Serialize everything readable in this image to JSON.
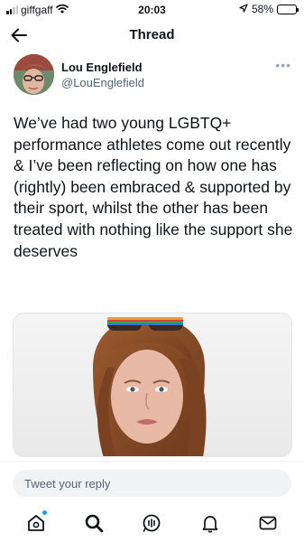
{
  "status_bar": {
    "carrier": "giffgaff",
    "time": "20:03",
    "battery": "58%",
    "battery_level": 0.58
  },
  "header": {
    "title": "Thread",
    "back_icon": "arrow-left-icon"
  },
  "author": {
    "name": "Lou Englefield",
    "handle": "@LouEnglefield",
    "more_icon": "more-horizontal-icon"
  },
  "tweet": {
    "text": "We’ve had two young LGBTQ+ performance athletes come out recently & I’ve been reflecting on how one has (rightly) been embraced & supported by their sport, whilst the other has been treated with nothing like the support she deserves"
  },
  "reply": {
    "placeholder": "Tweet your reply"
  },
  "nav": {
    "items": [
      "home-icon",
      "search-icon",
      "spaces-icon",
      "notifications-icon",
      "messages-icon"
    ],
    "accent": "#1d9bf0"
  }
}
